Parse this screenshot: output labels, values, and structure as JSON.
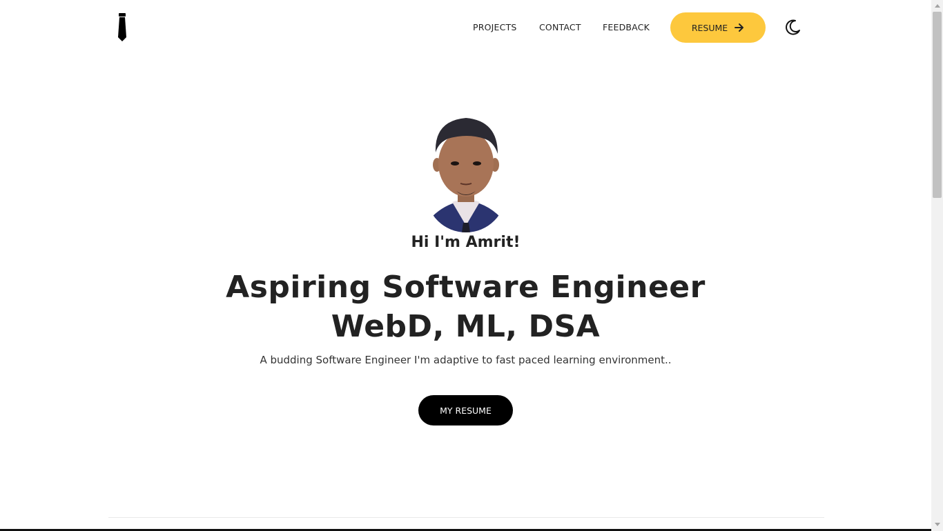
{
  "header": {
    "logo_icon": "necktie-icon",
    "nav": [
      {
        "label": "PROJECTS"
      },
      {
        "label": "CONTACT"
      },
      {
        "label": "FEEDBACK"
      }
    ],
    "resume_button": {
      "label": "RESUME",
      "icon": "arrow-right-icon",
      "color": "#fdc83d"
    },
    "theme_toggle_icon": "moon-icon"
  },
  "hero": {
    "greeting": "Hi I'm Amrit!",
    "headline_line1": "Aspiring Software Engineer",
    "headline_line2": "WebD, ML, DSA",
    "tagline": "A budding Software Engineer I'm adaptive to fast paced learning environment..",
    "cta_label": "MY RESUME"
  },
  "colors": {
    "accent": "#fdc83d",
    "text": "#222222",
    "cta_bg": "#000000"
  }
}
